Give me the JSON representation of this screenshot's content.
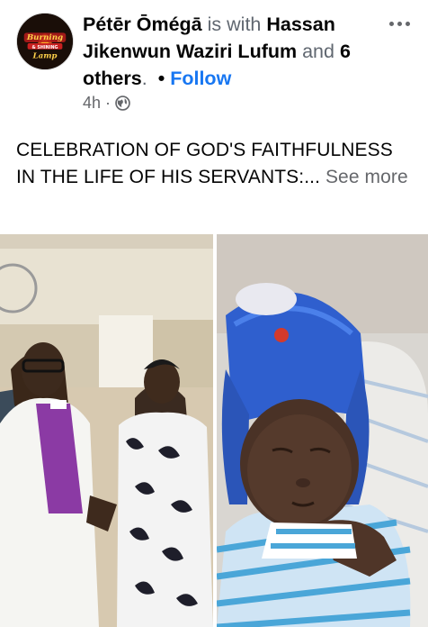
{
  "post": {
    "author": "Pétēr Ōmégā",
    "with_text": "is with",
    "tagged_person": "Hassan Jikenwun Waziri Lufum",
    "and_text": "and",
    "others": "6 others",
    "period": ".",
    "separator": "•",
    "follow_label": "Follow",
    "time": "4h",
    "time_separator": "·",
    "body_text": "CELEBRATION OF GOD'S FAITHFULNESS IN THE LIFE OF HIS SERVANTS:...",
    "see_more_label": "See more",
    "icons": {
      "privacy": "globe-icon",
      "more": "more-options-icon"
    }
  },
  "avatar": {
    "logo_lines": [
      "Burning",
      "& SHINING",
      "Lamp"
    ]
  },
  "photos": [
    {
      "description_name": "photo-couple-church"
    },
    {
      "description_name": "photo-newborn-baby"
    }
  ],
  "colors": {
    "link_blue": "#1877f2",
    "secondary_text": "#65676b"
  }
}
